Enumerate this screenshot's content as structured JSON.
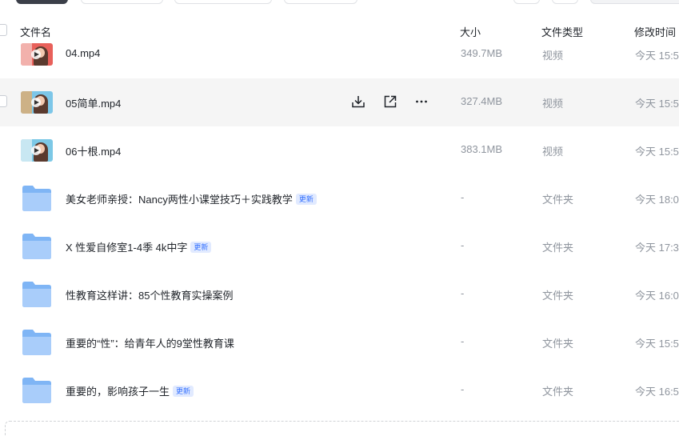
{
  "columns": {
    "name": "文件名",
    "size": "大小",
    "type": "文件类型",
    "modified": "修改时间"
  },
  "rows": [
    {
      "kind": "video",
      "name": "04.mp4",
      "size": "349.7MB",
      "type": "视频",
      "modified": "今天 15:5",
      "thumb_bg": "#e8605a",
      "thumb_accent": "#f7d4cf"
    },
    {
      "kind": "video",
      "name": "05简单.mp4",
      "size": "327.4MB",
      "type": "视频",
      "modified": "今天 15:5",
      "thumb_bg": "#7cc6e8",
      "thumb_accent": "#f0a85c"
    },
    {
      "kind": "video",
      "name": "06十根.mp4",
      "size": "383.1MB",
      "type": "视频",
      "modified": "今天 15:5",
      "thumb_bg": "#7cc8e6",
      "thumb_accent": "#e8f3f7"
    },
    {
      "kind": "folder",
      "name": "美女老师亲授：Nancy两性小课堂技巧＋实践教学",
      "badge": "更新",
      "size": "-",
      "type": "文件夹",
      "modified": "今天 18:0"
    },
    {
      "kind": "folder",
      "name": "X 性爱自修室1-4季 4k中字",
      "badge": "更新",
      "size": "-",
      "type": "文件夹",
      "modified": "今天 17:3"
    },
    {
      "kind": "folder",
      "name": "性教育这样讲：85个性教育实操案例",
      "size": "-",
      "type": "文件夹",
      "modified": "今天 16:0"
    },
    {
      "kind": "folder",
      "name": "重要的“性”：给青年人的9堂性教育课",
      "size": "-",
      "type": "文件夹",
      "modified": "今天 15:5"
    },
    {
      "kind": "folder",
      "name": "重要的，影响孩子一生",
      "badge": "更新",
      "size": "-",
      "type": "文件夹",
      "modified": "今天 16:5"
    }
  ],
  "hover_row": 1,
  "row_actions": [
    {
      "icon": "download-icon"
    },
    {
      "icon": "share-icon"
    },
    {
      "icon": "more-icon"
    }
  ],
  "colors": {
    "folder": "#7fb5f5",
    "badge_text": "#3370ff",
    "badge_bg": "#e1eaff",
    "hover_bg": "#f5f5f5"
  }
}
